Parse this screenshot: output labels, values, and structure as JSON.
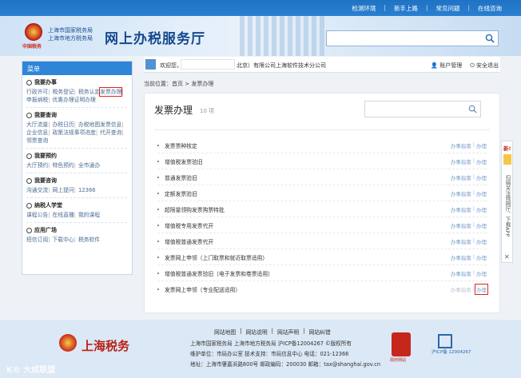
{
  "top_links": [
    "检测环境",
    "新手上路",
    "常见问题",
    "在线咨询"
  ],
  "header": {
    "emblem_text": "中国税务",
    "org_line1": "上海市国家税务局",
    "org_line2": "上海市地方税务局",
    "title": "网上办税服务厅"
  },
  "userbar": {
    "welcome": "欢迎您，",
    "company_suffix": "北京）有限公司上海软件技术分公司",
    "account": "账户管理",
    "logout": "安全退出"
  },
  "menu": {
    "header": "菜单",
    "sections": [
      {
        "title": "我要办事",
        "links": [
          "行政许可",
          "税务登记",
          "税务认定",
          "发票办理",
          "申报纳税",
          "优惠办理",
          "证明办理"
        ]
      },
      {
        "title": "我要查询",
        "links": [
          "大厅流量",
          "办税日历",
          "办税地图",
          "发票信息",
          "企业信息",
          "政策法规",
          "事项进度",
          "代开查询",
          "领票查询"
        ]
      },
      {
        "title": "我要预约",
        "links": [
          "大厅预约",
          "特色预约",
          "全市通办"
        ]
      },
      {
        "title": "我要咨询",
        "links": [
          "沟通交流",
          "网上提问",
          "12366"
        ]
      },
      {
        "title": "纳税人学堂",
        "links": [
          "课程公告",
          "在线直播",
          "我的课程"
        ]
      },
      {
        "title": "应用广场",
        "links": [
          "短信订阅",
          "下载中心",
          "税务软件"
        ]
      }
    ]
  },
  "breadcrumb": "当前位置：首页 > 发票办理",
  "panel": {
    "title": "发票办理",
    "count": "10 项",
    "rows": [
      {
        "title": "发票票种核定",
        "guide": "办事指南",
        "action": "办理"
      },
      {
        "title": "增值税发票验旧",
        "guide": "办事指南",
        "action": "办理"
      },
      {
        "title": "普通发票验旧",
        "guide": "办事指南",
        "action": "办理"
      },
      {
        "title": "定额发票验旧",
        "guide": "办事指南",
        "action": "办理"
      },
      {
        "title": "超限量领购发票购票特批",
        "guide": "办事指南",
        "action": "办理"
      },
      {
        "title": "增值税专用发票代开",
        "guide": "办事指南",
        "action": "办理"
      },
      {
        "title": "增值税普通发票代开",
        "guide": "办事指南",
        "action": "办理"
      },
      {
        "title": "发票网上申领（上门取票和就近取票适用）",
        "guide": "办事指南",
        "action": "办理"
      },
      {
        "title": "增值税普通发票验旧（电子发票和卷票适用）",
        "guide": "办事指南",
        "action": "办理"
      },
      {
        "title": "发票网上申领（专业配送适用）",
        "guide": "办事指南",
        "action": "办理"
      }
    ]
  },
  "side_float": {
    "new_label": "新!",
    "text": "扫描关注微网厅、下载APP",
    "close": "✕"
  },
  "footer": {
    "links": [
      "网站地图",
      "网站说明",
      "网站声明",
      "网站纠错"
    ],
    "line1": "上海市国家税务局 上海市地方税务局 沪ICP备12004267 ©版权所有",
    "line2": "维护单位：市局办公室   技术支持：市局信息中心 电话：021-12366",
    "line3": "地址：上海市肇嘉浜路800号   邮政编码：200030   邮箱：tax@shanghai.gov.cn",
    "logo_text": "上海税务",
    "badge1_label": "政府网站",
    "badge2_label": "沪ICP备 12004267"
  },
  "watermark": "K© 大成联盟"
}
